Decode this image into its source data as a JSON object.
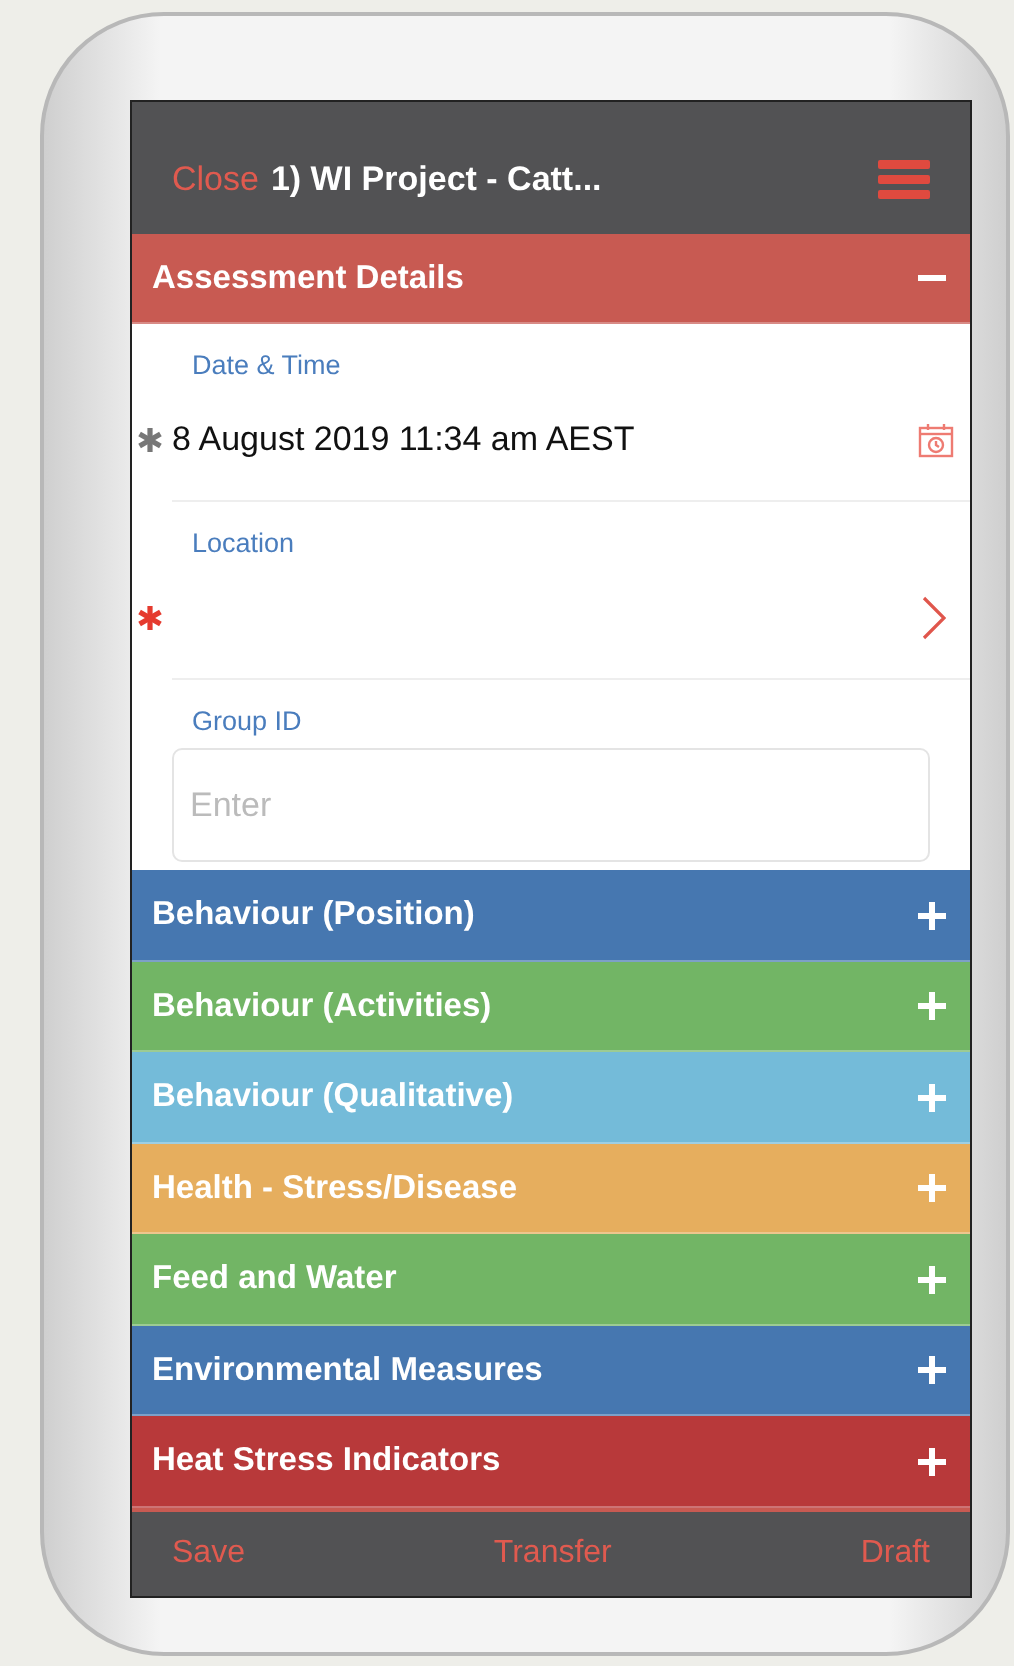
{
  "header": {
    "close": "Close",
    "title": "1) WI Project - Catt..."
  },
  "sections": [
    {
      "title": "Assessment Details",
      "color": "#c85a52",
      "expanded": true,
      "fields": [
        {
          "kind": "date",
          "label": "Date & Time",
          "value": "8 August 2019 11:34 am AEST",
          "missing": false
        },
        {
          "kind": "picker",
          "label": "Location",
          "missing": true
        },
        {
          "kind": "text",
          "label": "Group ID",
          "placeholder": "Enter"
        }
      ]
    },
    {
      "title": "Behaviour (Position)",
      "color": "#4677b0",
      "expanded": false
    },
    {
      "title": "Behaviour (Activities)",
      "color": "#72b565",
      "expanded": false
    },
    {
      "title": "Behaviour (Qualitative)",
      "color": "#74bbd9",
      "expanded": false
    },
    {
      "title": "Health - Stress/Disease",
      "color": "#e6ae5e",
      "expanded": false
    },
    {
      "title": "Feed and Water",
      "color": "#72b565",
      "expanded": false
    },
    {
      "title": "Environmental Measures",
      "color": "#4677b0",
      "expanded": false
    },
    {
      "title": "Heat Stress Indicators",
      "color": "#b8393a",
      "expanded": false
    }
  ],
  "footer": [
    "Save",
    "Transfer",
    "Draft"
  ]
}
